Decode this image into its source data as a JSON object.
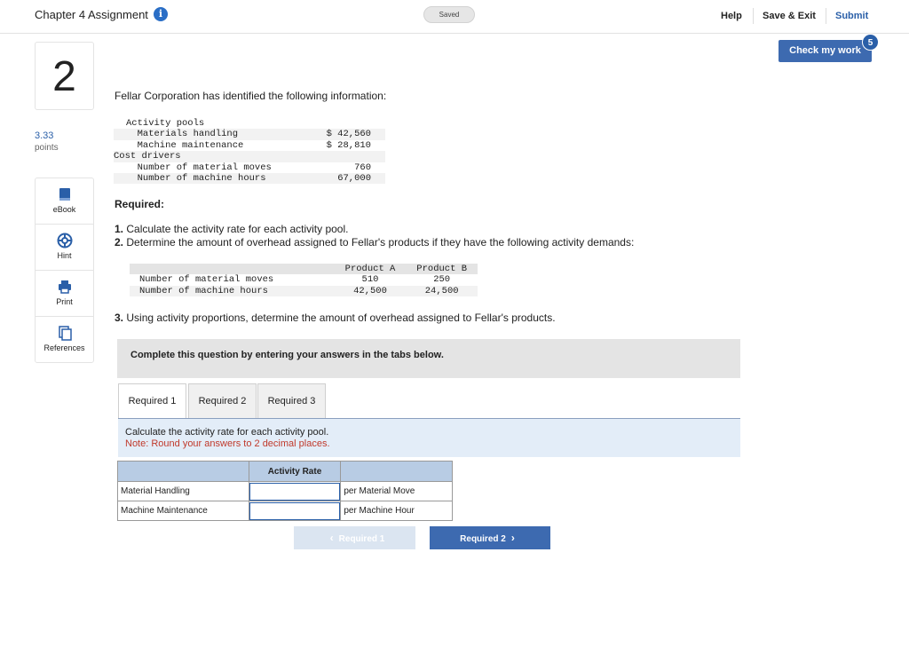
{
  "header": {
    "chapter_title": "Chapter 4 Assignment",
    "info_icon": "i",
    "saved_label": "Saved",
    "help_label": "Help",
    "save_exit_label": "Save & Exit",
    "submit_label": "Submit",
    "check_label": "Check my work",
    "check_badge": "5"
  },
  "sidebar": {
    "question_number": "2",
    "points_value": "3.33",
    "points_label": "points",
    "tools": [
      {
        "label": "eBook",
        "icon": "book-icon"
      },
      {
        "label": "Hint",
        "icon": "hint-icon"
      },
      {
        "label": "Print",
        "icon": "print-icon"
      },
      {
        "label": "References",
        "icon": "references-icon"
      }
    ]
  },
  "question": {
    "prompt": "Fellar Corporation has identified the following information:",
    "info_rows": [
      {
        "label": "Activity pools",
        "value": ""
      },
      {
        "label": "  Materials handling",
        "value": "$ 42,560"
      },
      {
        "label": "  Machine maintenance",
        "value": "$ 28,810"
      },
      {
        "label": "Cost drivers",
        "value": ""
      },
      {
        "label": "  Number of material moves",
        "value": "760"
      },
      {
        "label": "  Number of machine hours",
        "value": "67,000"
      }
    ],
    "required_heading": "Required:",
    "req1_num": "1.",
    "req1_text": "Calculate the activity rate for each activity pool.",
    "req2_num": "2.",
    "req2_text": "Determine the amount of overhead assigned to Fellar's products if they have the following activity demands:",
    "demand_headers": [
      "",
      "Product A",
      "Product B"
    ],
    "demand_rows": [
      {
        "label": "Number of material moves",
        "a": "510",
        "b": "250"
      },
      {
        "label": "Number of machine hours",
        "a": "42,500",
        "b": "24,500"
      }
    ],
    "req3_num": "3.",
    "req3_text": "Using activity proportions, determine the amount of overhead assigned to Fellar's products."
  },
  "answer_area": {
    "complete_text": "Complete this question by entering your answers in the tabs below.",
    "tabs": [
      "Required 1",
      "Required 2",
      "Required 3"
    ],
    "instruction": "Calculate the activity rate for each activity pool.",
    "note": "Note: Round your answers to 2 decimal places.",
    "table_header": "Activity Rate",
    "rows": [
      {
        "label": "Material Handling",
        "value": "",
        "unit": "per Material Move"
      },
      {
        "label": "Machine Maintenance",
        "value": "",
        "unit": "per Machine Hour"
      }
    ],
    "prev_label": "Required 1",
    "next_label": "Required 2"
  }
}
